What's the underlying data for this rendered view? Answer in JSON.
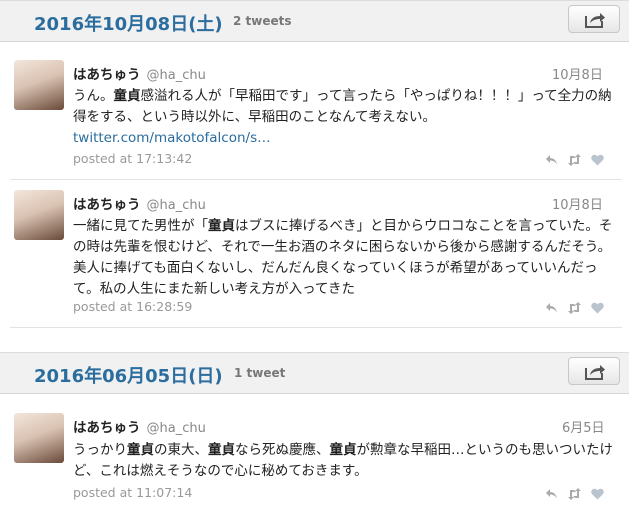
{
  "days": [
    {
      "date": "2016年10月08日(土)",
      "count": "2 tweets",
      "tweets": [
        {
          "name": "はあちゅう",
          "handle": "@ha_chu",
          "date": "10月8日",
          "text": [
            "うん。",
            {
              "b": "童貞"
            },
            "感溢れる人が「早稲田です」って言ったら「やっぱりね！！！」って全力の納得をする、という時以外に、早稲田のことなんて考えない。"
          ],
          "link": "twitter.com/makotofalcon/s…",
          "posted": "posted at 17:13:42"
        },
        {
          "name": "はあちゅう",
          "handle": "@ha_chu",
          "date": "10月8日",
          "text": [
            "一緒に見てた男性が「",
            {
              "b": "童貞"
            },
            "はブスに捧げるべき」と目からウロコなことを言っていた。その時は先輩を恨むけど、それで一生お酒のネタに困らないから後から感謝するんだそう。美人に捧げても面白くないし、だんだん良くなっていくほうが希望があっていいんだって。私の人生にまた新しい考え方が入ってきた"
          ],
          "link": "",
          "posted": "posted at 16:28:59"
        }
      ]
    },
    {
      "date": "2016年06月05日(日)",
      "count": "1 tweet",
      "tweets": [
        {
          "name": "はあちゅう",
          "handle": "@ha_chu",
          "date": "6月5日",
          "text": [
            "うっかり",
            {
              "b": "童貞"
            },
            "の東大、",
            {
              "b": "童貞"
            },
            "なら死ぬ慶應、",
            {
              "b": "童貞"
            },
            "が勲章な早稲田…というのも思いついたけど、これは燃えそうなので心に秘めておきます。"
          ],
          "link": "",
          "posted": "posted at 11:07:14"
        }
      ]
    }
  ],
  "icons": {
    "reply": "reply-icon",
    "retweet": "retweet-icon",
    "favorite": "heart-icon",
    "share": "share-icon"
  },
  "colors": {
    "date": "#2a6d9e",
    "link": "#2a6d9e",
    "muted": "#999999"
  }
}
